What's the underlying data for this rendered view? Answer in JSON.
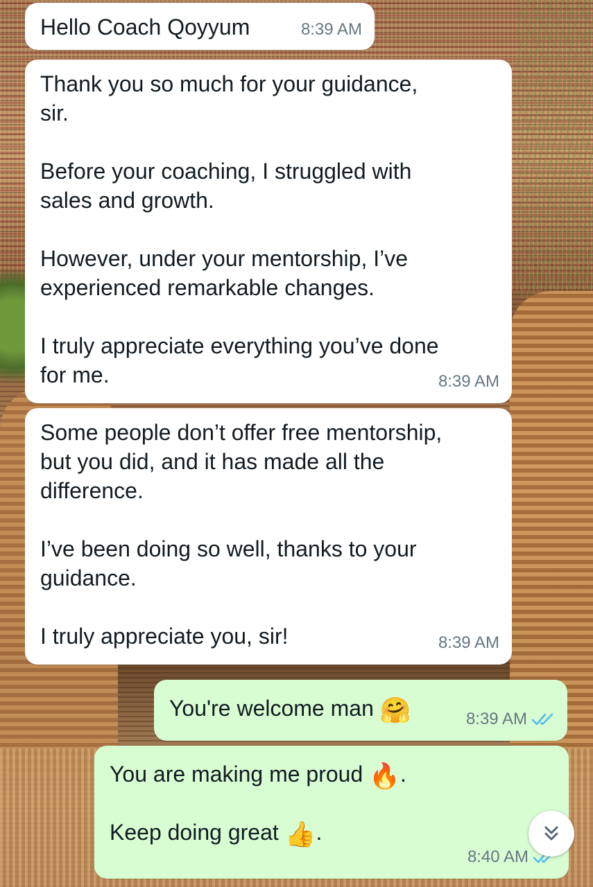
{
  "messages": [
    {
      "direction": "incoming",
      "text": "Hello Coach Qoyyum",
      "time": "8:39 AM"
    },
    {
      "direction": "incoming",
      "text": "Thank you so much for your guidance,\nsir.\n\nBefore your coaching, I struggled with\nsales and growth.\n\nHowever, under your mentorship, I’ve\nexperienced remarkable changes.\n\nI truly appreciate everything you’ve done\nfor me.",
      "time": "8:39 AM"
    },
    {
      "direction": "incoming",
      "text": "Some people don’t offer free mentorship,\nbut you did, and it has made all the\ndifference.\n\nI’ve been doing so well, thanks to your\nguidance.\n\nI truly appreciate you, sir!",
      "time": "8:39 AM"
    },
    {
      "direction": "outgoing",
      "text": "You're welcome man",
      "emoji": "🤗",
      "time": "8:39 AM",
      "status": "read"
    },
    {
      "direction": "outgoing",
      "line1": "You are making me proud",
      "emoji1": "🔥",
      "line1_end": ".",
      "line2": "Keep doing great",
      "emoji2": "👍",
      "line2_end": ".",
      "time": "8:40 AM",
      "status": "read"
    }
  ],
  "colors": {
    "incoming_bubble": "#ffffff",
    "outgoing_bubble": "#d9fdd3",
    "read_tick": "#53bdeb",
    "meta_text": "#667781"
  },
  "icons": {
    "read_receipt": "double-check-icon",
    "scroll_down": "chevron-double-down-icon"
  }
}
